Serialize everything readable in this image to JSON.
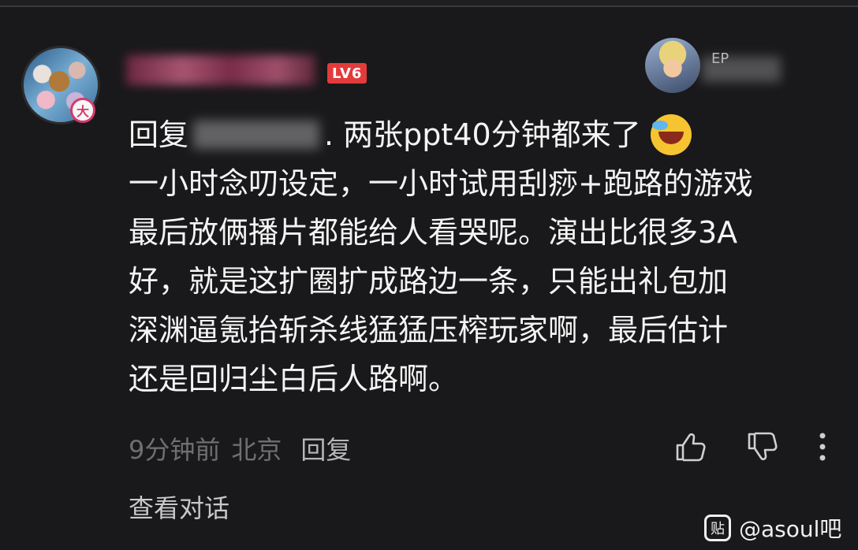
{
  "comment": {
    "level": "LV6",
    "avatar_badge": "大",
    "op_name": "EP",
    "reply_prefix": "回复",
    "reply_suffix": ". 两张ppt40分钟都来了",
    "body_lines": [
      "一小时念叨设定，一小时试用刮痧+跑路的游戏",
      "最后放俩播片都能给人看哭呢。演出比很多3A",
      "好，就是这扩圈扩成路边一条，只能出礼包加",
      "深渊逼氪抬斩杀线猛猛压榨玩家啊，最后估计",
      "还是回归尘白后人路啊。"
    ],
    "time": "9分钟前",
    "location": "北京",
    "reply_button": "回复",
    "view_thread": "查看对话"
  },
  "watermark": {
    "logo": "贴",
    "text": "@asoul吧"
  },
  "icons": [
    "thumbs-up-icon",
    "thumbs-down-icon",
    "more-vertical-icon",
    "laughing-crying-emoji"
  ],
  "colors": {
    "background": "#19181a",
    "level_badge": "#e33b3b",
    "meta_text": "#6f6e70"
  }
}
